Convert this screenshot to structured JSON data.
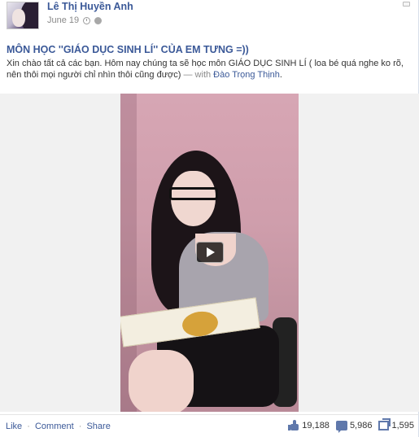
{
  "post": {
    "author": "Lê Thị Huyền Anh",
    "date": "June 19",
    "title": "MÔN HỌC ''GIÁO DỤC SINH LÍ'' CỦA EM TƯNG =))",
    "description": "Xin chào tất cả các bạn. Hôm nay chúng ta sẽ học môn GIÁO DỤC SINH LÍ ( loa bé quá nghe ko rõ, nên thôi mọi người chỉ nhìn thôi cũng được)",
    "with_prefix": " — with ",
    "tagged": "Đào Trọng Thịnh",
    "tagged_suffix": "."
  },
  "actions": {
    "like": "Like",
    "comment": "Comment",
    "share": "Share",
    "separator": "·"
  },
  "counts": {
    "likes": "19,188",
    "comments": "5,986",
    "shares": "1,595"
  },
  "icons": {
    "clock": "clock-icon",
    "globe": "globe-icon",
    "play": "play-icon",
    "like": "thumbs-up-icon",
    "comment": "comment-icon",
    "share": "share-icon"
  },
  "colors": {
    "link": "#3b5998",
    "meta": "#8a8a8a",
    "icon": "#5f78ab"
  }
}
